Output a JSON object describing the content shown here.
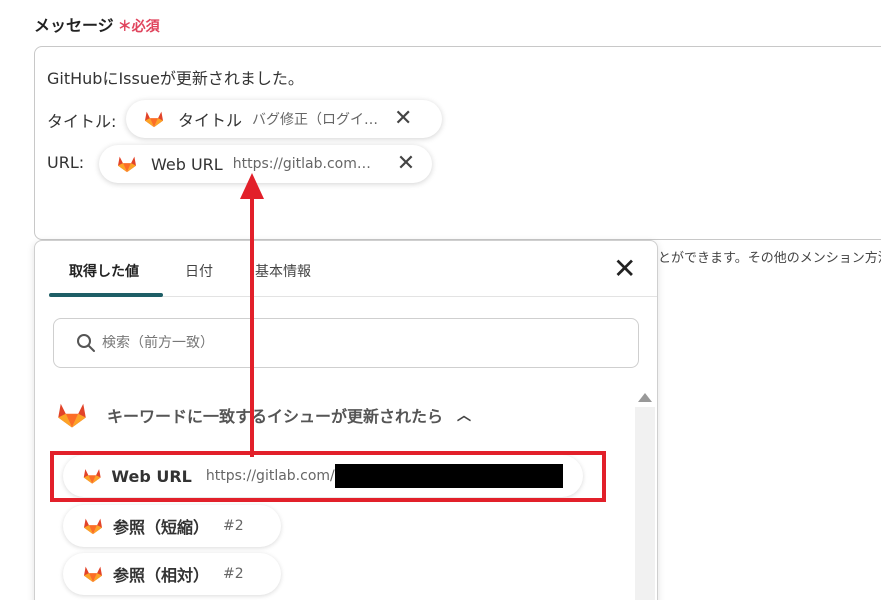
{
  "field": {
    "label": "メッセージ",
    "required": "＊必須"
  },
  "message": {
    "line1": "GitHubにIssueが更新されました。",
    "title_prefix": "タイトル:",
    "url_prefix": "URL:"
  },
  "chips": [
    {
      "label": "タイトル",
      "value": "バグ修正（ログイン・…"
    },
    {
      "label": "Web URL",
      "value": "https://gitlab.com…"
    }
  ],
  "hint": "とができます。その他のメンション方法",
  "panel": {
    "tabs": [
      "取得した値",
      "日付",
      "基本情報"
    ],
    "active_tab": 0,
    "search_placeholder": "検索（前方一致）",
    "group_title": "キーワードに一致するイシューが更新されたら",
    "items": [
      {
        "label": "Web URL",
        "value": "https://gitlab.com/"
      },
      {
        "label": "参照（短縮）",
        "value": "#2"
      },
      {
        "label": "参照（相対）",
        "value": "#2"
      }
    ]
  },
  "colors": {
    "gitlab_orange": "#e24329",
    "highlight_red": "#e2202a",
    "tab_accent": "#1e5e66",
    "required_pink": "#e0445d"
  },
  "icons": {
    "chip": "gitlab-fox-icon",
    "remove": "close-icon",
    "search": "search-icon",
    "collapse": "chevron-up-icon"
  }
}
